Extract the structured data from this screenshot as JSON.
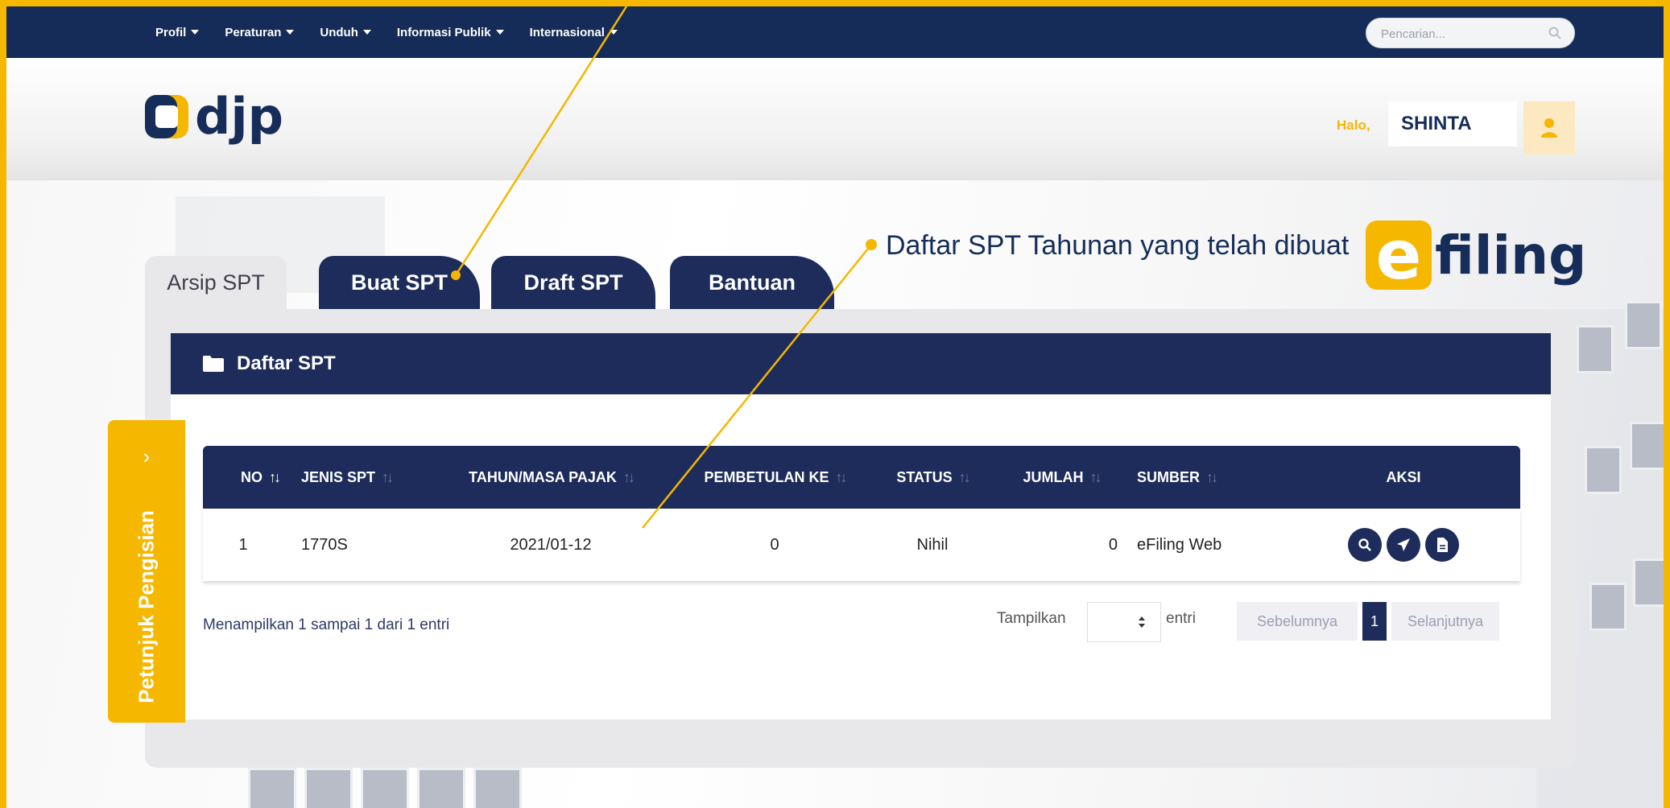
{
  "topnav": {
    "items": [
      {
        "label": "Profil"
      },
      {
        "label": "Peraturan"
      },
      {
        "label": "Unduh"
      },
      {
        "label": "Informasi Publik"
      },
      {
        "label": "Internasional"
      }
    ],
    "search_placeholder": "Pencarian..."
  },
  "header": {
    "logo_text": "djp",
    "greeting": "Halo,",
    "username": "SHINTA"
  },
  "tabs": [
    {
      "label": "Arsip SPT",
      "active": true
    },
    {
      "label": "Buat SPT",
      "active": false
    },
    {
      "label": "Draft SPT",
      "active": false
    },
    {
      "label": "Bantuan",
      "active": false
    }
  ],
  "annotation": {
    "text": "Daftar SPT Tahunan yang telah dibuat"
  },
  "efiling": {
    "letter": "e",
    "word": "filing"
  },
  "panel": {
    "title": "Daftar SPT",
    "columns": [
      "NO",
      "JENIS SPT",
      "TAHUN/MASA PAJAK",
      "PEMBETULAN KE",
      "STATUS",
      "JUMLAH",
      "SUMBER",
      "AKSI"
    ],
    "rows": [
      {
        "no": "1",
        "jenis": "1770S",
        "tahun": "2021/01-12",
        "pembetulan": "0",
        "status": "Nihil",
        "jumlah": "0",
        "sumber": "eFiling Web"
      }
    ],
    "actions": [
      "search-icon",
      "send-icon",
      "document-icon"
    ],
    "info": "Menampilkan 1 sampai 1 dari 1 entri",
    "show_label": "Tampilkan",
    "entri_label": "entri",
    "prev_label": "Sebelumnya",
    "page": "1",
    "next_label": "Selanjutnya"
  },
  "side_guide": {
    "label": "Petunjuk Pengisian",
    "chevron": "›"
  },
  "colors": {
    "navy": "#1d2c5a",
    "accent": "#f5b700",
    "panel_bg": "#e8e8eb"
  }
}
